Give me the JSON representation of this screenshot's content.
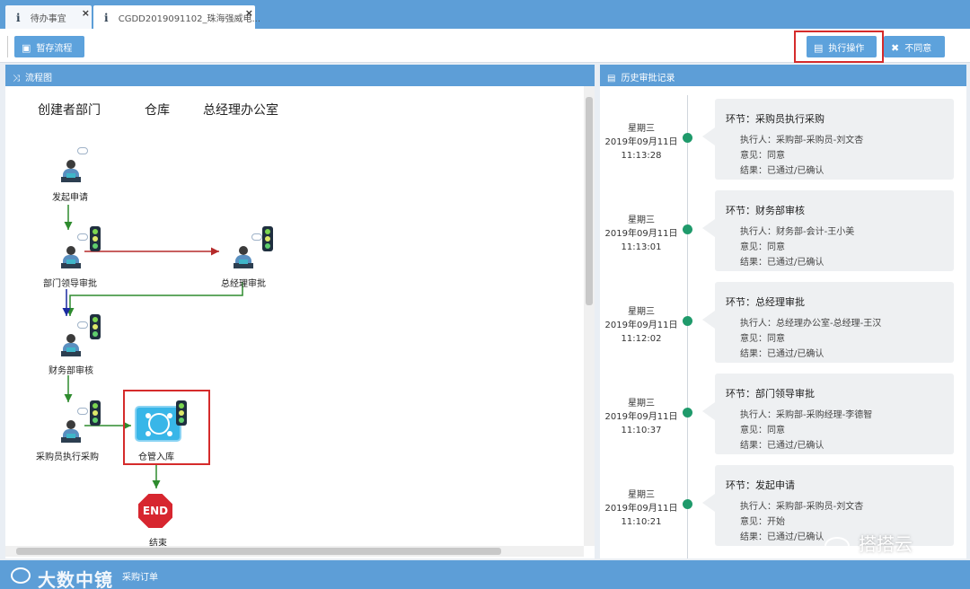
{
  "tabs": [
    {
      "label": "待办事宜",
      "icon": "info-icon"
    },
    {
      "label": "CGDD2019091102_珠海强威电...",
      "icon": "info-icon"
    }
  ],
  "toolbar": {
    "save_label": "暂存流程",
    "execute_label": "执行操作",
    "disagree_label": "不同意"
  },
  "flow_panel": {
    "title": "流程图",
    "lanes": [
      "创建者部门",
      "仓库",
      "总经理办公室"
    ],
    "nodes": {
      "start": "发起申请",
      "dept_leader": "部门领导审批",
      "general_manager": "总经理审批",
      "finance": "财务部审核",
      "buyer": "采购员执行采购",
      "warehouse": "仓管入库",
      "end": "结束",
      "end_sign": "END"
    }
  },
  "history_panel": {
    "title": "历史审批记录",
    "records": [
      {
        "weekday": "星期三",
        "date": "2019年09月11日",
        "time": "11:13:28",
        "step": "环节：采购员执行采购",
        "executor": "执行人：采购部-采购员-刘文杏",
        "opinion": "意见：同意",
        "result": "结果：已通过/已确认"
      },
      {
        "weekday": "星期三",
        "date": "2019年09月11日",
        "time": "11:13:01",
        "step": "环节：财务部审核",
        "executor": "执行人：财务部-会计-王小美",
        "opinion": "意见：同意",
        "result": "结果：已通过/已确认"
      },
      {
        "weekday": "星期三",
        "date": "2019年09月11日",
        "time": "11:12:02",
        "step": "环节：总经理审批",
        "executor": "执行人：总经理办公室-总经理-王汉",
        "opinion": "意见：同意",
        "result": "结果：已通过/已确认"
      },
      {
        "weekday": "星期三",
        "date": "2019年09月11日",
        "time": "11:10:37",
        "step": "环节：部门领导审批",
        "executor": "执行人：采购部-采购经理-李德智",
        "opinion": "意见：同意",
        "result": "结果：已通过/已确认"
      },
      {
        "weekday": "星期三",
        "date": "2019年09月11日",
        "time": "11:10:21",
        "step": "环节：发起申请",
        "executor": "执行人：采购部-采购员-刘文杏",
        "opinion": "意见：开始",
        "result": "结果：已通过/已确认"
      }
    ]
  },
  "statusbar": {
    "text": "采购订单",
    "watermark_left": "大数中镜",
    "watermark_right": "搭搭云"
  },
  "colors": {
    "accent": "#5d9ed7",
    "highlight": "#d52b2b",
    "timeline_dot": "#1f9a6b",
    "arrow_green": "#2e8b2e",
    "arrow_red": "#b52a2a"
  }
}
